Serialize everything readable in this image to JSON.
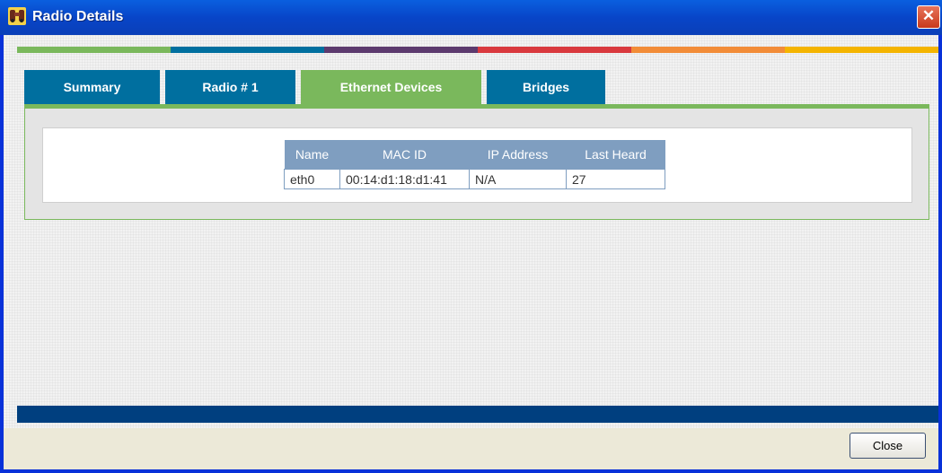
{
  "window": {
    "title": "Radio Details",
    "close_glyph": "✕"
  },
  "stripe_colors": [
    "#7ab85c",
    "#006f9f",
    "#5c3a6e",
    "#d9393e",
    "#f28c38",
    "#f4b400"
  ],
  "tabs": [
    {
      "label": "Summary",
      "active": false
    },
    {
      "label": "Radio # 1",
      "active": false
    },
    {
      "label": "Ethernet Devices",
      "active": true
    },
    {
      "label": "Bridges",
      "active": false
    }
  ],
  "ethernet_table": {
    "headers": [
      "Name",
      "MAC ID",
      "IP Address",
      "Last Heard"
    ],
    "rows": [
      [
        "eth0",
        "00:14:d1:18:d1:41",
        "N/A",
        "27"
      ]
    ]
  },
  "footer": {
    "close_label": "Close"
  },
  "colors": {
    "accent_green": "#7ab85c",
    "tab_blue": "#006f9f",
    "bottom_bar": "#003f7f",
    "table_header": "#7f9ec0"
  }
}
